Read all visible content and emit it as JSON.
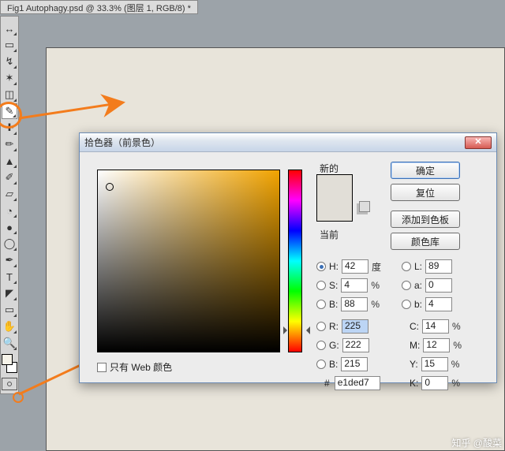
{
  "doc_tab": "Fig1 Autophagy.psd @ 33.3% (图层 1, RGB/8) *",
  "toolbar": {
    "tools": [
      {
        "name": "move-tool",
        "glyph": "↔"
      },
      {
        "name": "rect-marquee-tool",
        "glyph": "▭"
      },
      {
        "name": "lasso-tool",
        "glyph": "↯"
      },
      {
        "name": "magic-wand-tool",
        "glyph": "✶"
      },
      {
        "name": "crop-tool",
        "glyph": "◫"
      },
      {
        "name": "eyedropper-tool",
        "glyph": "✎"
      },
      {
        "name": "healing-brush-tool",
        "glyph": "✚"
      },
      {
        "name": "brush-tool",
        "glyph": "✏"
      },
      {
        "name": "clone-stamp-tool",
        "glyph": "▲"
      },
      {
        "name": "history-brush-tool",
        "glyph": "✐"
      },
      {
        "name": "eraser-tool",
        "glyph": "▱"
      },
      {
        "name": "paint-bucket-tool",
        "glyph": "◔"
      },
      {
        "name": "blur-tool",
        "glyph": "●"
      },
      {
        "name": "dodge-tool",
        "glyph": "◯"
      },
      {
        "name": "pen-tool",
        "glyph": "✒"
      },
      {
        "name": "type-tool",
        "glyph": "T"
      },
      {
        "name": "path-select-tool",
        "glyph": "◤"
      },
      {
        "name": "shape-tool",
        "glyph": "▭"
      },
      {
        "name": "hand-tool",
        "glyph": "✋"
      },
      {
        "name": "zoom-tool",
        "glyph": "🔍"
      }
    ]
  },
  "dialog": {
    "title": "拾色器（前景色）",
    "new_label": "新的",
    "current_label": "当前",
    "buttons": {
      "ok": "确定",
      "reset": "复位",
      "add_swatch": "添加到色板",
      "libs": "颜色库"
    },
    "hsb": {
      "h_label": "H:",
      "h": "42",
      "h_unit": "度",
      "s_label": "S:",
      "s": "4",
      "s_unit": "%",
      "b_label": "B:",
      "b": "88",
      "b_unit": "%"
    },
    "lab": {
      "l_label": "L:",
      "l": "89",
      "a_label": "a:",
      "a": "0",
      "b_label": "b:",
      "b": "4"
    },
    "rgb": {
      "r_label": "R:",
      "r": "225",
      "g_label": "G:",
      "g": "222",
      "b_label": "B:",
      "b": "215"
    },
    "cmyk": {
      "c_label": "C:",
      "c": "14",
      "m_label": "M:",
      "m": "12",
      "y_label": "Y:",
      "y": "15",
      "k_label": "K:",
      "k": "0",
      "unit": "%"
    },
    "hex_label": "#",
    "hex": "e1ded7",
    "web_only": "只有 Web 颜色"
  },
  "watermark": "知乎 @酸菜"
}
